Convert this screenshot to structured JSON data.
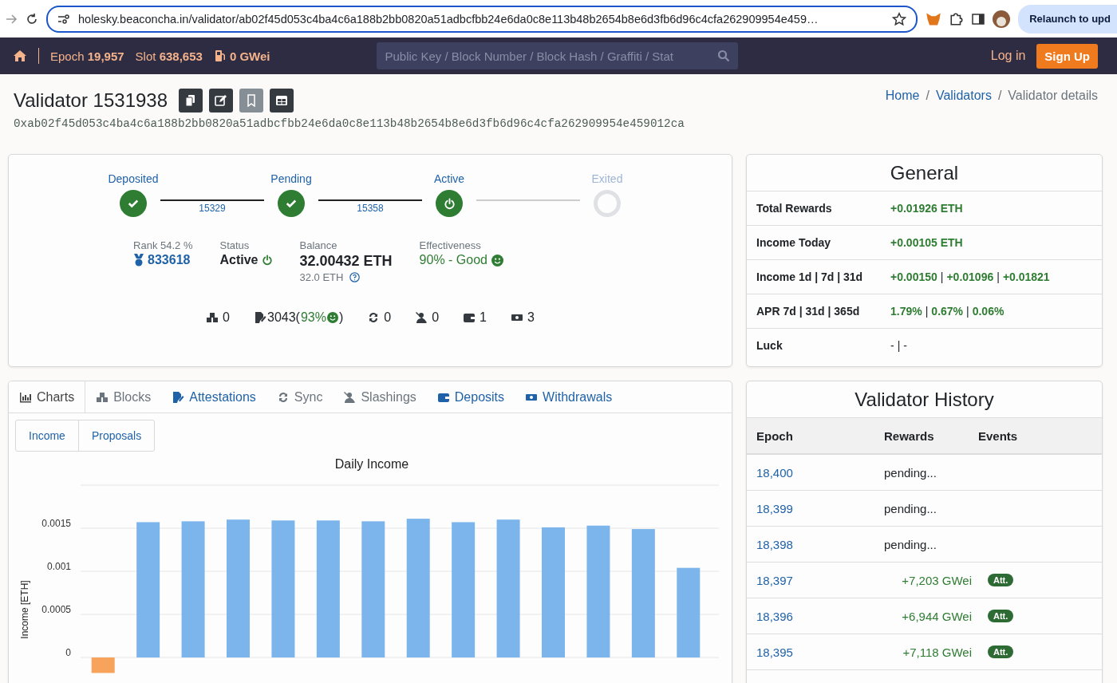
{
  "browser": {
    "url": "holesky.beaconcha.in/validator/ab02f45d053c4ba4c6a188b2bb0820a51adbcfbb24e6da0c8e113b48b2654b8e6d3fb6d96c4cfa262909954e459…",
    "relaunch": "Relaunch to upd"
  },
  "navbar": {
    "epoch_label": "Epoch",
    "epoch": "19,957",
    "slot_label": "Slot",
    "slot": "638,653",
    "gas": "0 GWei",
    "search": {
      "placeholder": "Public Key / Block Number / Block Hash / Graffiti / Stat"
    },
    "login": "Log in",
    "signup": "Sign Up"
  },
  "header": {
    "title": "Validator 1531938",
    "pubkey": "0xab02f45d053c4ba4c6a188b2bb0820a51adbcfbb24e6da0c8e113b48b2654b8e6d3fb6d96c4cfa262909954e459012ca",
    "actions": [
      {
        "kind": "copy",
        "disabled": false
      },
      {
        "kind": "edit",
        "disabled": false
      },
      {
        "kind": "bookmark",
        "disabled": true
      },
      {
        "kind": "table",
        "disabled": false
      }
    ],
    "breadcrumb_separator": "/",
    "breadcrumb": [
      {
        "label": "Home"
      },
      {
        "label": "Validators"
      },
      {
        "label": "Validator details"
      }
    ]
  },
  "lifecycle": {
    "steps": [
      {
        "label": "Deposited",
        "reached": true,
        "current": false
      },
      {
        "label": "Pending",
        "reached": true,
        "current": false
      },
      {
        "label": "Active",
        "reached": true,
        "current": true
      },
      {
        "label": "Exited",
        "reached": false,
        "current": false
      }
    ],
    "connectors": [
      {
        "label": "15329",
        "reached": true
      },
      {
        "label": "15358",
        "reached": true
      },
      {
        "reached": false
      }
    ]
  },
  "stats": {
    "rank_label": "Rank 54.2 %",
    "rank": "833618",
    "status_label": "Status",
    "status": "Active",
    "balance_label": "Balance",
    "balance": "32.00432 ETH",
    "effective_balance": "32.0 ETH",
    "effectiveness_label": "Effectiveness",
    "effectiveness": "90% - Good"
  },
  "counters": [
    {
      "kind": "blocks",
      "value": "0"
    },
    {
      "kind": "attestations",
      "value": "3043(",
      "detail": "93%",
      "suffix": ")"
    },
    {
      "kind": "sync",
      "value": "0"
    },
    {
      "kind": "slashings",
      "value": "0"
    },
    {
      "kind": "deposits",
      "value": "1"
    },
    {
      "kind": "withdrawals",
      "value": "3"
    }
  ],
  "general": {
    "title": "General",
    "rows": [
      {
        "label": "Total Rewards",
        "values": [
          "+0.01926 ETH"
        ],
        "positive": true
      },
      {
        "label": "Income Today",
        "values": [
          "+0.00105 ETH"
        ],
        "positive": true
      },
      {
        "label": "Income 1d | 7d | 31d",
        "values": [
          "+0.00150",
          "+0.01096",
          "+0.01821"
        ],
        "separator": "|",
        "positive": true
      },
      {
        "label": "APR 7d | 31d | 365d",
        "values": [
          "1.79%",
          "0.67%",
          "0.06%"
        ],
        "separator": "|",
        "positive": true
      },
      {
        "label": "Luck",
        "values": [
          "-",
          "-"
        ],
        "separator": "|",
        "positive": false
      }
    ]
  },
  "tabs": [
    {
      "label": "Charts",
      "kind": "charts",
      "selected": true,
      "disabled": false
    },
    {
      "label": "Blocks",
      "kind": "blocks",
      "selected": false,
      "disabled": true
    },
    {
      "label": "Attestations",
      "kind": "attestations",
      "selected": false,
      "disabled": false
    },
    {
      "label": "Sync",
      "kind": "sync",
      "selected": false,
      "disabled": true
    },
    {
      "label": "Slashings",
      "kind": "slashings",
      "selected": false,
      "disabled": true
    },
    {
      "label": "Deposits",
      "kind": "deposits",
      "selected": false,
      "disabled": false
    },
    {
      "label": "Withdrawals",
      "kind": "withdrawals",
      "selected": false,
      "disabled": false
    }
  ],
  "subtabs": [
    {
      "label": "Income",
      "selected": false
    },
    {
      "label": "Proposals",
      "selected": false
    }
  ],
  "chart_data": {
    "type": "bar",
    "title": "Daily Income",
    "ylabel": "Income [ETH]",
    "grid": true,
    "ylim": [
      -0.0002,
      0.002
    ],
    "yticks": [
      0,
      0.0005,
      0.001,
      0.0015
    ],
    "series": [
      {
        "color": "#7cb5ec",
        "values": [
          null,
          0.00157,
          0.00158,
          0.0016,
          0.00159,
          0.00159,
          0.00158,
          0.00161,
          0.00157,
          0.0016,
          0.00151,
          0.00153,
          0.00149,
          0.00104
        ]
      },
      {
        "color": "#f7a35c",
        "values": [
          -0.00018,
          null,
          null,
          null,
          null,
          null,
          null,
          null,
          null,
          null,
          null,
          null,
          null,
          null
        ]
      }
    ]
  },
  "history": {
    "title": "Validator History",
    "columns": [
      "Epoch",
      "Rewards",
      "Events"
    ],
    "rows": [
      {
        "epoch": "18,400",
        "rewards": "pending...",
        "pending": true
      },
      {
        "epoch": "18,399",
        "rewards": "pending...",
        "pending": true
      },
      {
        "epoch": "18,398",
        "rewards": "pending...",
        "pending": true
      },
      {
        "epoch": "18,397",
        "rewards": "+7,203 GWei",
        "pending": false,
        "events": [
          "Att."
        ]
      },
      {
        "epoch": "18,396",
        "rewards": "+6,944 GWei",
        "pending": false,
        "events": [
          "Att."
        ]
      },
      {
        "epoch": "18,395",
        "rewards": "+7,118 GWei",
        "pending": false,
        "events": [
          "Att."
        ]
      }
    ]
  }
}
